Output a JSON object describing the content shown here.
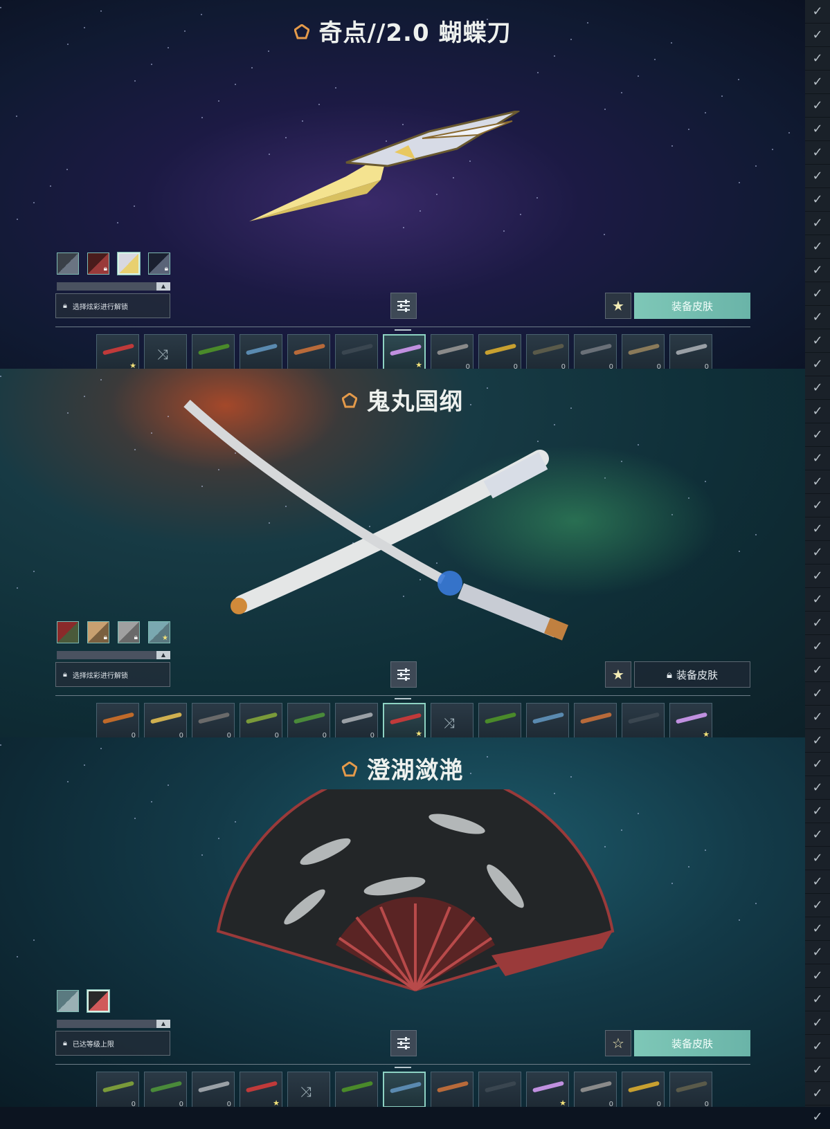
{
  "panels": [
    {
      "title": "奇点//2.0 蝴蝶刀",
      "tier_color": "#e49a4a",
      "chromas": [
        {
          "colors": [
            "#3a4048",
            "#6a7482"
          ],
          "locked": false,
          "selected": false
        },
        {
          "colors": [
            "#4a1c1c",
            "#9a3a3a"
          ],
          "locked": true,
          "selected": false
        },
        {
          "colors": [
            "#d8d8e0",
            "#e8d070"
          ],
          "locked": false,
          "selected": true
        },
        {
          "colors": [
            "#1a2030",
            "#5a6478"
          ],
          "locked": true,
          "selected": false
        }
      ],
      "lock_text": "选择炫彩进行解锁",
      "equip_label": "装备皮肤",
      "equip_state": "active",
      "fav_icon": "★",
      "skins": [
        {
          "color": "#c03a3a",
          "mark": "fav"
        },
        {
          "color": "",
          "mark": "random"
        },
        {
          "color": "#4a8a2a",
          "mark": ""
        },
        {
          "color": "#5a8ab0",
          "mark": ""
        },
        {
          "color": "#b86a3a",
          "mark": ""
        },
        {
          "color": "#3a4650",
          "mark": ""
        },
        {
          "color": "#c090e0",
          "mark": "fav"
        },
        {
          "color": "#8a8a8a",
          "mark": "lvl"
        },
        {
          "color": "#c8a030",
          "mark": "lvl"
        },
        {
          "color": "#5a5a4a",
          "mark": "lvl"
        },
        {
          "color": "#6a7078",
          "mark": "lvl"
        },
        {
          "color": "#8a7a5a",
          "mark": "lvl"
        },
        {
          "color": "#9aa0a6",
          "mark": "lvl"
        }
      ]
    },
    {
      "title": "鬼丸国纲",
      "tier_color": "#e49a4a",
      "chromas": [
        {
          "colors": [
            "#8a2a2a",
            "#4a5a3a"
          ],
          "locked": false,
          "selected": false
        },
        {
          "colors": [
            "#c8a070",
            "#7a6040"
          ],
          "locked": true,
          "selected": false
        },
        {
          "colors": [
            "#a0a0a0",
            "#6a6a6a"
          ],
          "locked": true,
          "selected": false
        },
        {
          "colors": [
            "#7aa8b0",
            "#5a7880"
          ],
          "locked": false,
          "selected": false,
          "fav": true
        }
      ],
      "lock_text": "选择炫彩进行解锁",
      "equip_label": "装备皮肤",
      "equip_state": "locked",
      "fav_icon": "★",
      "skins": [
        {
          "color": "#c06a2a",
          "mark": "lvl"
        },
        {
          "color": "#d0b050",
          "mark": "lvl"
        },
        {
          "color": "#6a6a6a",
          "mark": "lvl"
        },
        {
          "color": "#7a9a3a",
          "mark": "lvl"
        },
        {
          "color": "#4a8a3a",
          "mark": "lvl"
        },
        {
          "color": "#9aa0a6",
          "mark": "lvl"
        },
        {
          "color": "#c03a3a",
          "mark": "fav"
        },
        {
          "color": "",
          "mark": "random"
        },
        {
          "color": "#4a8a2a",
          "mark": ""
        },
        {
          "color": "#5a8ab0",
          "mark": ""
        },
        {
          "color": "#b86a3a",
          "mark": ""
        },
        {
          "color": "#3a4650",
          "mark": ""
        },
        {
          "color": "#c090e0",
          "mark": "fav"
        }
      ]
    },
    {
      "title": "澄湖潋滟",
      "tier_color": "#e49a4a",
      "chromas": [
        {
          "colors": [
            "#5a7a80",
            "#9ab0b4"
          ],
          "locked": false,
          "selected": false
        },
        {
          "colors": [
            "#2a2a2a",
            "#d05a5a"
          ],
          "locked": false,
          "selected": true
        }
      ],
      "lock_text": "已达等级上限",
      "equip_label": "装备皮肤",
      "equip_state": "active",
      "fav_icon": "☆",
      "skins": [
        {
          "color": "#7a9a3a",
          "mark": "lvl"
        },
        {
          "color": "#4a8a3a",
          "mark": "lvl"
        },
        {
          "color": "#9aa0a6",
          "mark": "lvl"
        },
        {
          "color": "#c03a3a",
          "mark": "fav"
        },
        {
          "color": "",
          "mark": "random"
        },
        {
          "color": "#4a8a2a",
          "mark": ""
        },
        {
          "color": "#5a8ab0",
          "mark": ""
        },
        {
          "color": "#b86a3a",
          "mark": ""
        },
        {
          "color": "#3a4650",
          "mark": ""
        },
        {
          "color": "#c090e0",
          "mark": "fav"
        },
        {
          "color": "#8a8a8a",
          "mark": "lvl"
        },
        {
          "color": "#c8a030",
          "mark": "lvl"
        },
        {
          "color": "#5a5a4a",
          "mark": "lvl"
        }
      ]
    }
  ],
  "sidebar_icon": "check-chevron-icon",
  "level_glyph": "0"
}
